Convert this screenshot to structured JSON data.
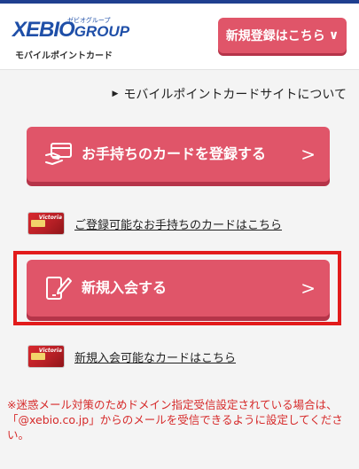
{
  "header": {
    "logo_main": "XEBIO",
    "logo_group": "GROUP",
    "logo_sub": "ゼビオグループ",
    "logo_caption": "モバイルポイントカード",
    "register_button": "新規登録はこちら",
    "register_chevron": "∨"
  },
  "about_link": {
    "marker": "▶",
    "label": "モバイルポイントカードサイトについて"
  },
  "register_card_button": {
    "label": "お手持ちのカードを登録する",
    "arrow": ">",
    "icon": "card-hand-icon"
  },
  "registrable_cards_link": {
    "label": "ご登録可能なお手持ちのカードはこちら",
    "card_brand": "Victoria"
  },
  "new_member_button": {
    "label": "新規入会する",
    "arrow": ">",
    "icon": "phone-pen-icon"
  },
  "new_member_cards_link": {
    "label": "新規入会可能なカードはこちら",
    "card_brand": "Victoria"
  },
  "notice": "※迷惑メール対策のためドメイン指定受信設定されている場合は、「@xebio.co.jp」からのメールを受信できるように設定してください。",
  "colors": {
    "accent": "#e05569",
    "accent_shadow": "#b53449",
    "brand_blue": "#1f4fa8",
    "highlight": "#e21b1b",
    "notice": "#d62a2a"
  }
}
